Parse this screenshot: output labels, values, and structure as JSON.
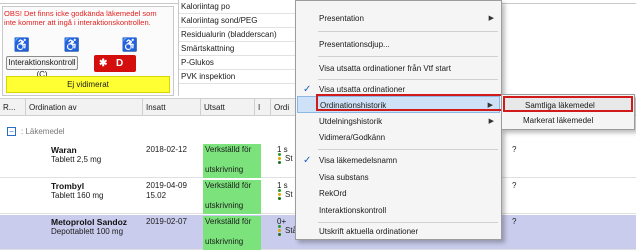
{
  "warning_panel": {
    "text": "OBS! Det finns icke godkända läkemedel som inte kommer att ingå i interaktionskontrollen.",
    "interaktion_button": "Interaktionskontroll (C)",
    "d_badge": "D",
    "d_badge_star": "✱",
    "ej_vidimerat": "Ej vidimerat"
  },
  "labels": [
    "Kaloriintag po",
    "Kaloriintag sond/PEG",
    "Residualurin (bladderscan)",
    "Smärtskattning",
    "P-Glukos",
    "PVK inspektion"
  ],
  "table": {
    "columns": [
      "R...",
      "Ordination av",
      "Insatt",
      "Utsatt",
      "I",
      "Ordi"
    ],
    "group_label": ": Läkemedel",
    "rows": [
      {
        "name": "Waran",
        "form": "Tablett 2,5 mg",
        "insatt": "2018-02-12",
        "insatt_extra": "",
        "status_l1": "Verkställd för",
        "status_l2": "utskrivning",
        "ord_l1": "1 s",
        "ord_l2": "St",
        "flag": "?"
      },
      {
        "name": "Trombyl",
        "form": "Tablett 160 mg",
        "insatt": "2019-04-09",
        "insatt_extra": "15.02",
        "status_l1": "Verkställd för",
        "status_l2": "utskrivning",
        "ord_l1": "1 s",
        "ord_l2": "St",
        "flag": "?"
      },
      {
        "name": "Metoprolol Sandoz",
        "form": "Depottablett 100 mg",
        "insatt": "2019-02-07",
        "insatt_extra": "",
        "status_l1": "Verkställd för",
        "status_l2": "utskrivning",
        "ord_l1": "0+",
        "ord_l2": "Stående po",
        "flag": "?"
      }
    ]
  },
  "context_menu": {
    "items": [
      {
        "label": "Presentation",
        "submenu": true
      },
      {
        "label": "Presentationsdjup..."
      },
      {
        "label": "Visa utsatta ordinationer från Vtf start"
      },
      {
        "label": "Visa utsatta ordinationer",
        "checked": true
      },
      {
        "label": "Ordinationshistorik",
        "submenu": true
      },
      {
        "label": "Utdelningshistorik",
        "submenu": true
      },
      {
        "label": "Vidimera/Godkänn"
      },
      {
        "label": "Visa läkemedelsnamn",
        "checked": true
      },
      {
        "label": "Visa substans"
      },
      {
        "label": "RekOrd"
      },
      {
        "label": "Interaktionskontroll"
      },
      {
        "label": "Utskrift aktuella ordinationer"
      }
    ],
    "arrow_glyph": "▶",
    "check_glyph": "✓"
  },
  "submenu": {
    "items": [
      "Samtliga läkemedel",
      "Markerat läkemedel"
    ]
  },
  "colors": {
    "warning_text": "#e32020",
    "d_badge": "#d40d0d",
    "ej_vidimerat_bg": "#ffff33",
    "status_green": "#7ce37c",
    "highlight_outline": "#d11a1a",
    "menu_highlight": "#cfe1f6",
    "selected_row": "#c9ccec"
  },
  "icons": [
    "person-disabled-icon",
    "person-disabled-icon",
    "person-disabled-icon",
    "expand-toggle-icon",
    "status-dots-icon",
    "submenu-arrow-icon",
    "checkmark-icon"
  ]
}
